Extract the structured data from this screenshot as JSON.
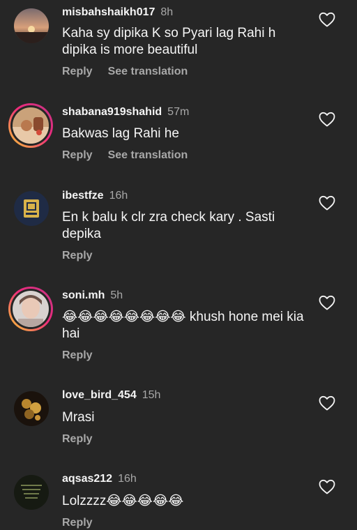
{
  "comments": [
    {
      "username": "misbahshaikh017",
      "time": "8h",
      "text": "Kaha sy dipika K so Pyari lag Rahi h dipika is more beautiful",
      "reply": "Reply",
      "translate": "See translation",
      "avatar": "sunset-photo"
    },
    {
      "username": "shabana919shahid",
      "time": "57m",
      "text": "Bakwas lag Rahi he",
      "reply": "Reply",
      "translate": "See translation",
      "avatar": "hands-photo"
    },
    {
      "username": "ibestfze",
      "time": "16h",
      "text": "En k balu k clr zra check kary . Sasti depika",
      "reply": "Reply",
      "avatar": "logo-badge"
    },
    {
      "username": "soni.mh",
      "time": "5h",
      "text": "😂😂😂😂😂😂😂😂 khush hone mei kia hai",
      "reply": "Reply",
      "avatar": "selfie-photo"
    },
    {
      "username": "love_bird_454",
      "time": "15h",
      "text": "Mrasi",
      "reply": "Reply",
      "avatar": "flowers-photo"
    },
    {
      "username": "aqsas212",
      "time": "16h",
      "text": "Lolzzzz😂😂😂😂😂",
      "reply": "Reply",
      "avatar": "text-photo"
    }
  ],
  "colors": {
    "background": "#262626",
    "text": "#f5f5f5",
    "muted": "#a8a8a8"
  },
  "icons": {
    "like": "heart-outline-icon"
  }
}
